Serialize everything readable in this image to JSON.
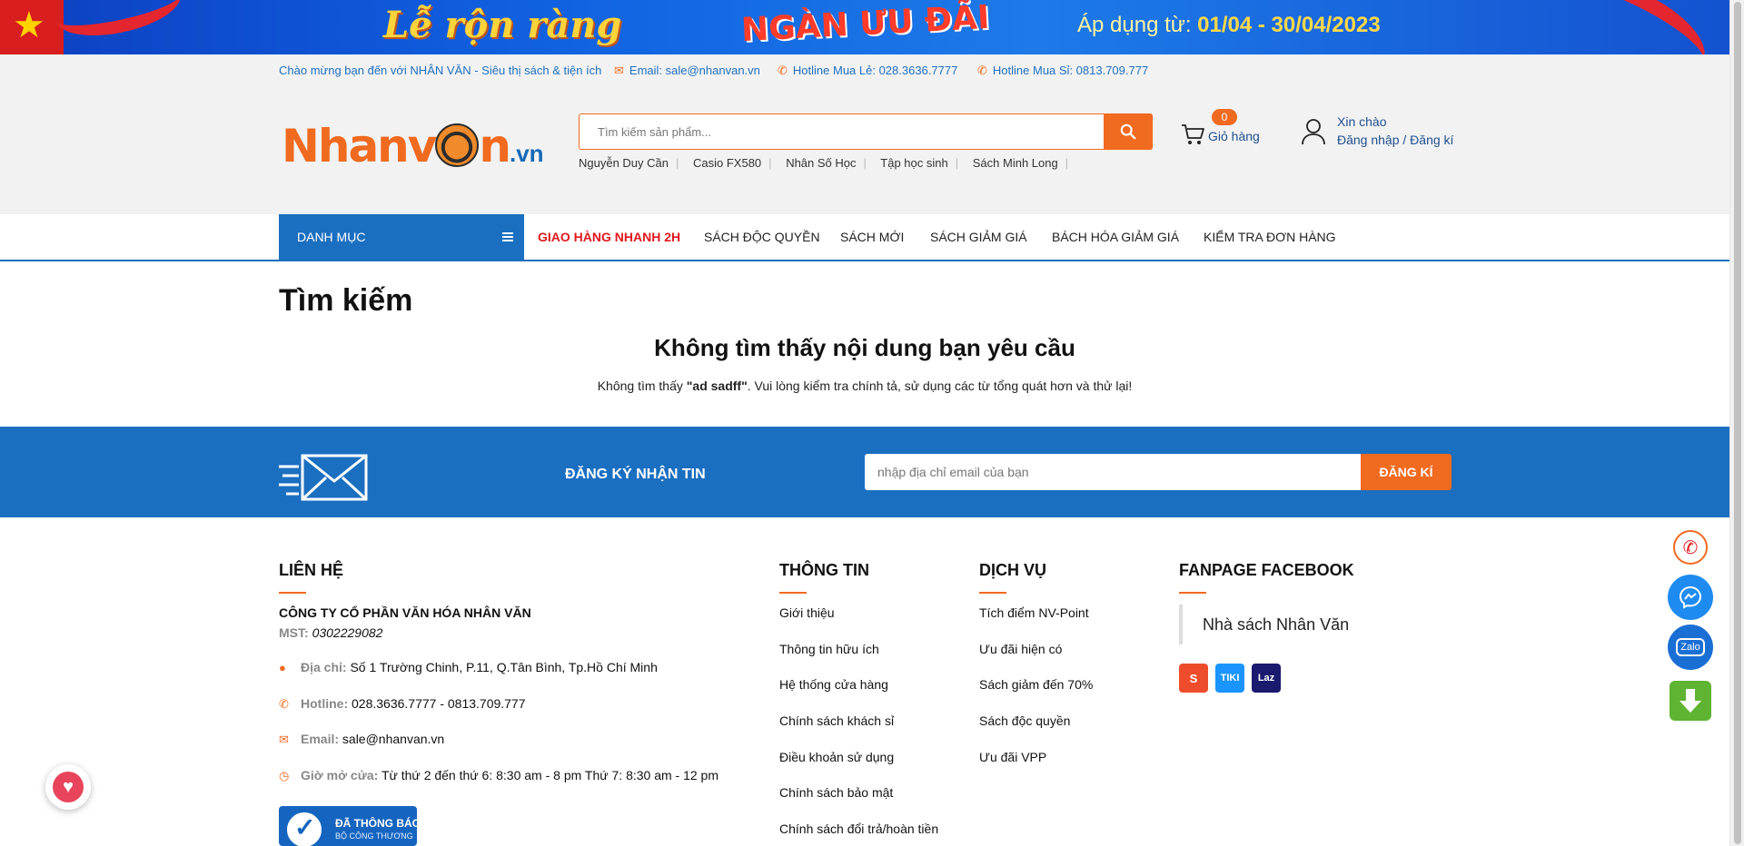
{
  "banner": {
    "left_text": "Lễ rộn ràng",
    "mid_text": "NGÀN ƯU ĐÃI",
    "right_prefix": "Áp dụng từ:",
    "right_dates": "01/04 - 30/04/2023"
  },
  "topbar": {
    "welcome": "Chào mừng bạn đến với NHÂN VĂN - Siêu thị sách & tiện ích",
    "email": "Email: sale@nhanvan.vn",
    "hotline_retail": "Hotline Mua Lẻ: 028.3636.7777",
    "hotline_wholesale": "Hotline Mua Sỉ: 0813.709.777"
  },
  "header": {
    "logo_word": "Nhanv",
    "logo_word_end": "n",
    "logo_suffix": ".vn",
    "search_placeholder": "Tìm kiếm sản phẩm...",
    "tags": [
      "Nguyễn Duy Cần",
      "Casio FX580",
      "Nhân Số Học",
      "Tập học sinh",
      "Sách Minh Long"
    ],
    "cart_count": "0",
    "cart_label": "Giỏ hàng",
    "greeting": "Xin chào",
    "login": "Đăng nhập / Đăng kí"
  },
  "nav": {
    "category": "DANH MỤC",
    "items": [
      "GIAO HÀNG NHANH 2H",
      "SÁCH ĐỘC QUYỀN",
      "SÁCH MỚI",
      "SÁCH GIẢM GIÁ",
      "BÁCH HÓA GIẢM GIÁ",
      "KIỂM TRA ĐƠN HÀNG"
    ]
  },
  "main": {
    "title": "Tìm kiếm",
    "not_found_title": "Không tìm thấy nội dung bạn yêu cầu",
    "not_found_prefix": "Không tìm thấy ",
    "query": "\"ad sadff\"",
    "not_found_suffix": ". Vui lòng kiểm tra chính tả, sử dụng các từ tổng quát hơn và thử lại!"
  },
  "newsletter": {
    "title": "ĐĂNG KÝ NHẬN TIN",
    "placeholder": "nhập địa chỉ email của bạn",
    "button": "ĐĂNG KÍ"
  },
  "footer": {
    "contact": {
      "heading": "LIÊN HỆ",
      "company": "CÔNG TY CỔ PHẦN VĂN HÓA NHÂN VĂN",
      "mst_label": "MST:",
      "mst_value": "0302229082",
      "address_label": "Địa chỉ:",
      "address": "Số 1 Trường Chinh, P.11, Q.Tân Bình, Tp.Hồ Chí Minh",
      "hotline_label": "Hotline:",
      "hotline": "028.3636.7777 - 0813.709.777",
      "email_label": "Email:",
      "email": "sale@nhanvan.vn",
      "hours_label": "Giờ mở cửa:",
      "hours": "Từ thứ 2 đến thứ 6: 8:30 am - 8 pm Thứ 7: 8:30 am - 12 pm",
      "badge_line1": "ĐÃ THÔNG BÁO",
      "badge_line2": "BỘ CÔNG THƯƠNG"
    },
    "info": {
      "heading": "THÔNG TIN",
      "links": [
        "Giới thiệu",
        "Thông tin hữu ích",
        "Hệ thống cửa hàng",
        "Chính sách khách sỉ",
        "Điều khoản sử dụng",
        "Chính sách bảo mật",
        "Chính sách đổi trả/hoàn tiền"
      ]
    },
    "services": {
      "heading": "DỊCH VỤ",
      "links": [
        "Tích điểm NV-Point",
        "Ưu đãi hiện có",
        "Sách giảm đến 70%",
        "Sách độc quyền",
        "Ưu đãi VPP"
      ]
    },
    "facebook": {
      "heading": "FANPAGE FACEBOOK",
      "page_name": "Nhà sách Nhân Văn",
      "marketplaces": [
        "S",
        "TIKI",
        "Laz"
      ]
    }
  },
  "floating": {
    "zalo": "Zalo"
  },
  "colors": {
    "brand_blue": "#1b6fc0",
    "brand_orange": "#f06a1f",
    "nav_red": "#e0191e",
    "shopee": "#ee4d2d",
    "tiki": "#1a94ff",
    "lazada": "#1a1a6e",
    "messenger": "#1e8bf1",
    "zalo": "#1a6fd4",
    "download": "#5fb432"
  },
  "icons": [
    "search-icon",
    "cart-icon",
    "user-icon",
    "envelope-icon",
    "phone-icon",
    "pin-icon",
    "clock-icon",
    "heart-icon",
    "messenger-icon",
    "download-icon",
    "menu-icon"
  ]
}
